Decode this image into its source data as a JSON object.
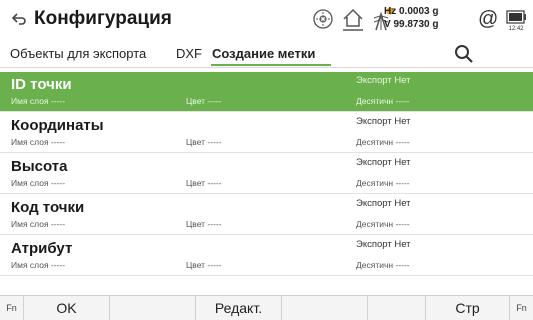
{
  "header": {
    "title": "Конфигурация",
    "hz_line": "Hz 0.0003 g",
    "v_line": "V  99.8730 g",
    "at_symbol": "@",
    "battery_time": "12:42"
  },
  "tabs": [
    {
      "label": "Объекты для экспорта"
    },
    {
      "label": "DXF"
    },
    {
      "label": "Создание метки",
      "active": true
    }
  ],
  "rows": [
    {
      "title": "ID точки",
      "layer_label": "Имя слоя -----",
      "color_label": "Цвет -----",
      "export_label": "Экспорт  Нет",
      "decimal_label": "Десятичн -----",
      "selected": true
    },
    {
      "title": "Координаты",
      "layer_label": "Имя слоя -----",
      "color_label": "Цвет -----",
      "export_label": "Экспорт  Нет",
      "decimal_label": "Десятичн -----"
    },
    {
      "title": "Высота",
      "layer_label": "Имя слоя -----",
      "color_label": "Цвет -----",
      "export_label": "Экспорт  Нет",
      "decimal_label": "Десятичн -----"
    },
    {
      "title": "Код точки",
      "layer_label": "Имя слоя -----",
      "color_label": "Цвет -----",
      "export_label": "Экспорт  Нет",
      "decimal_label": "Десятичн -----"
    },
    {
      "title": "Атрибут",
      "layer_label": "Имя слоя -----",
      "color_label": "Цвет -----",
      "export_label": "Экспорт  Нет",
      "decimal_label": "Десятичн -----"
    }
  ],
  "softkeys": {
    "fn_left": "Fn",
    "ok": "OK",
    "blank1": "",
    "edit": "Редакт.",
    "blank2": "",
    "blank3": "",
    "page": "Стр",
    "fn_right": "Fn"
  },
  "colors": {
    "accent": "#6ab04c",
    "text": "#1a1a1a"
  },
  "icons": {
    "back": "back-arrow-icon",
    "instrument": "instrument-reflector-icon",
    "home": "home-icon",
    "target": "target-signal-icon",
    "battery": "battery-icon",
    "search": "search-icon"
  }
}
